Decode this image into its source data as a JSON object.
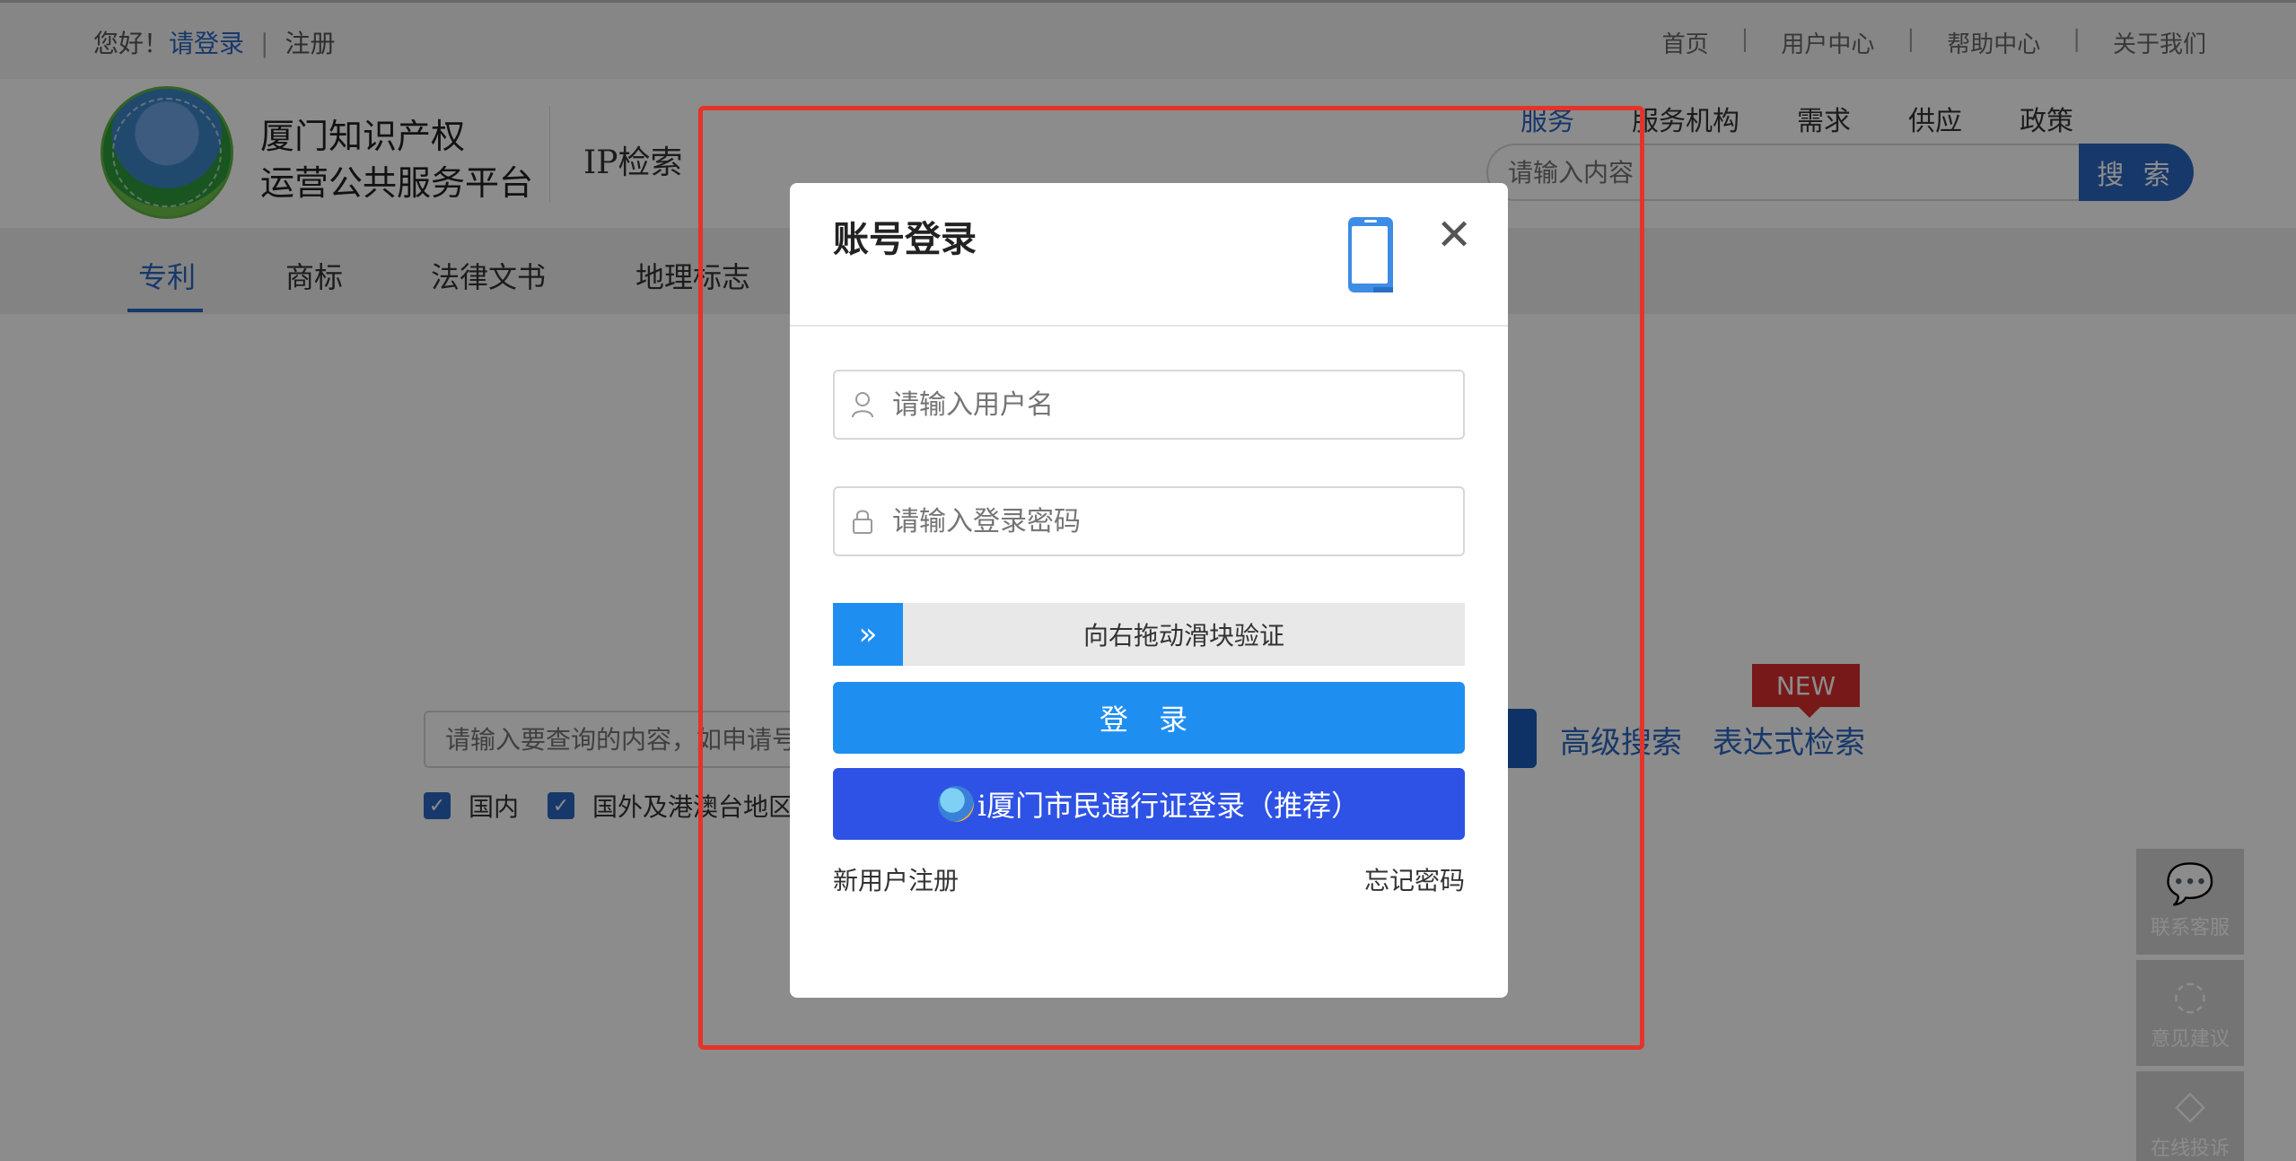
{
  "topbar": {
    "greeting": "您好！",
    "login_link": "请登录",
    "separator": "|",
    "register_link": "注册",
    "links": [
      "首页",
      "用户中心",
      "帮助中心",
      "关于我们"
    ]
  },
  "header": {
    "title_line1": "厦门知识产权",
    "title_line2": "运营公共服务平台",
    "section": "IP检索",
    "nav": [
      "服务",
      "服务机构",
      "需求",
      "供应",
      "政策"
    ],
    "search_placeholder": "请输入内容",
    "search_button": "搜 索"
  },
  "tabs": [
    "专利",
    "商标",
    "法律文书",
    "地理标志"
  ],
  "main_search": {
    "placeholder": "请输入要查询的内容，如申请号",
    "advanced": "高级搜索",
    "expression": "表达式检索",
    "badge": "NEW",
    "checks": [
      "国内",
      "国外及港澳台地区"
    ]
  },
  "side_widgets": [
    "联系客服",
    "意见建议",
    "在线投诉"
  ],
  "modal": {
    "title": "账号登录",
    "username_placeholder": "请输入用户名",
    "password_placeholder": "请输入登录密码",
    "slider_handle": "»",
    "slider_text": "向右拖动滑块验证",
    "login_button": "登 录",
    "citizen_button": "i厦门市民通行证登录（推荐）",
    "register": "新用户注册",
    "forgot": "忘记密码"
  },
  "colors": {
    "accent": "#2b67c1",
    "primary_button": "#1f8ef1",
    "citizen_button": "#2e52e6",
    "highlight_frame": "#e5332a",
    "badge": "#d92f2f"
  }
}
